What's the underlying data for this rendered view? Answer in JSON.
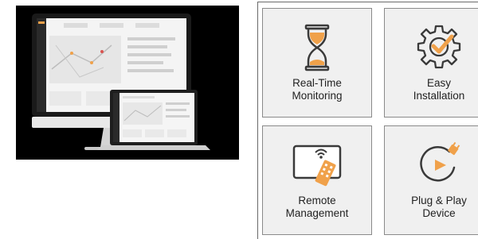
{
  "colors": {
    "accent": "#f0a14a",
    "icon_stroke": "#3a3a3a",
    "tile_bg": "#f0f0f0"
  },
  "features": [
    {
      "icon": "hourglass-icon",
      "line1": "Real-Time",
      "line2": "Monitoring"
    },
    {
      "icon": "gear-check-icon",
      "line1": "Easy",
      "line2": "Installation"
    },
    {
      "icon": "remote-control-icon",
      "line1": "Remote",
      "line2": "Management"
    },
    {
      "icon": "plug-play-icon",
      "line1": "Plug & Play",
      "line2": "Device"
    }
  ]
}
